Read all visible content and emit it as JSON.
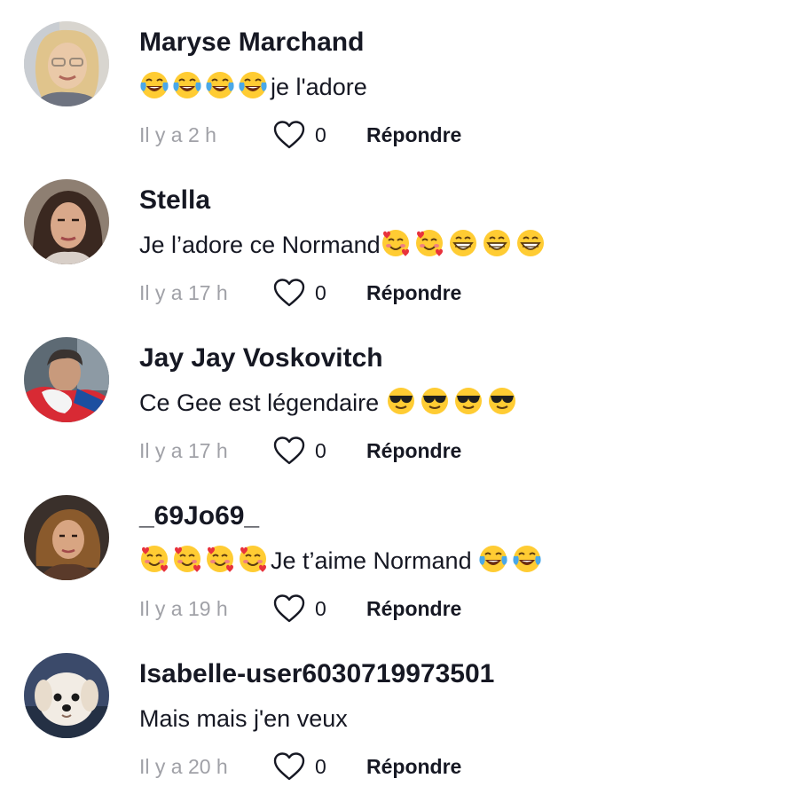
{
  "comments": [
    {
      "username": "Maryse Marchand",
      "text_before": "",
      "emojis_lead": [
        "face-with-tears-of-joy",
        "face-with-tears-of-joy",
        "face-with-tears-of-joy",
        "face-with-tears-of-joy"
      ],
      "text": "je l'adore",
      "emojis_trail": [],
      "time": "Il y a 2 h",
      "likes": "0",
      "reply_label": "Répondre"
    },
    {
      "username": "Stella",
      "text": "Je l’adore ce Normand",
      "emojis_lead": [],
      "emojis_trail": [
        "smiling-face-with-hearts",
        "smiling-face-with-hearts",
        "grinning-face",
        "grinning-face",
        "grinning-face"
      ],
      "time": "Il y a 17 h",
      "likes": "0",
      "reply_label": "Répondre"
    },
    {
      "username": "Jay Jay Voskovitch",
      "text": "Ce Gee est légendaire ",
      "emojis_lead": [],
      "emojis_trail": [
        "sunglasses-face",
        "sunglasses-face",
        "sunglasses-face",
        "sunglasses-face"
      ],
      "time": "Il y a 17 h",
      "likes": "0",
      "reply_label": "Répondre"
    },
    {
      "username": "_69Jo69_",
      "text": "Je t’aime Normand ",
      "emojis_lead": [
        "smiling-face-with-hearts",
        "smiling-face-with-hearts",
        "smiling-face-with-hearts",
        "smiling-face-with-hearts"
      ],
      "emojis_trail": [
        "face-with-tears-of-joy",
        "face-with-tears-of-joy"
      ],
      "time": "Il y a 19 h",
      "likes": "0",
      "reply_label": "Répondre"
    },
    {
      "username": "Isabelle-user6030719973501",
      "text": "Mais mais j'en veux",
      "emojis_lead": [],
      "emojis_trail": [],
      "time": "Il y a 20 h",
      "likes": "0",
      "reply_label": "Répondre"
    }
  ],
  "icons": {
    "like": "heart-outline-icon"
  },
  "colors": {
    "text": "#161823",
    "muted": "#a0a1a7"
  }
}
